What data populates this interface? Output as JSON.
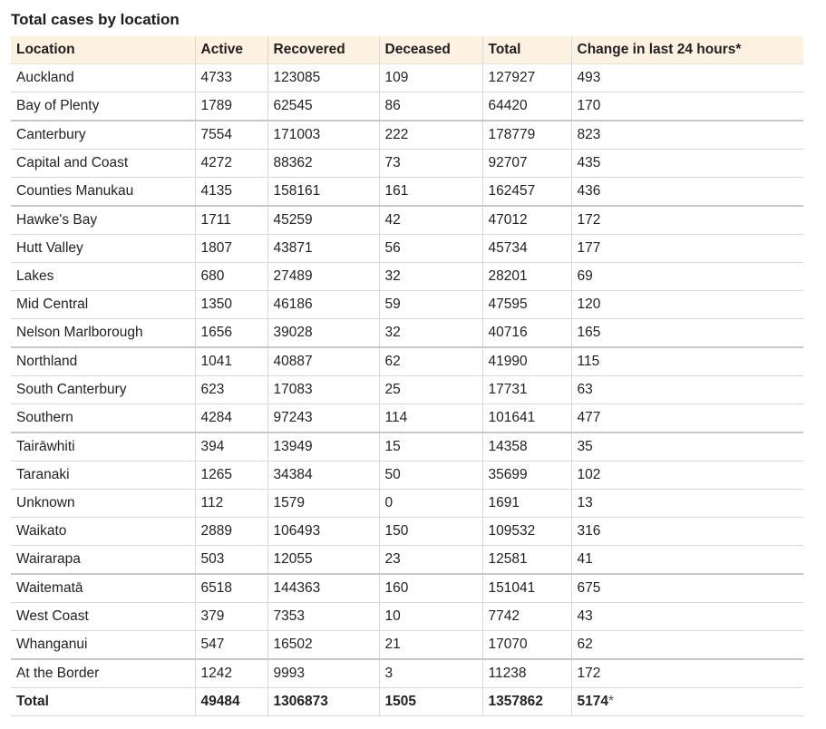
{
  "title": "Total cases by location",
  "columns": [
    "Location",
    "Active",
    "Recovered",
    "Deceased",
    "Total",
    "Change in last 24 hours*"
  ],
  "rows": [
    [
      "Auckland",
      "4733",
      "123085",
      "109",
      "127927",
      "493"
    ],
    [
      "Bay of Plenty",
      "1789",
      "62545",
      "86",
      "64420",
      "170"
    ],
    [
      "Canterbury",
      "7554",
      "171003",
      "222",
      "178779",
      "823"
    ],
    [
      "Capital and Coast",
      "4272",
      "88362",
      "73",
      "92707",
      "435"
    ],
    [
      "Counties Manukau",
      "4135",
      "158161",
      "161",
      "162457",
      "436"
    ],
    [
      "Hawke's Bay",
      "1711",
      "45259",
      "42",
      "47012",
      "172"
    ],
    [
      "Hutt Valley",
      "1807",
      "43871",
      "56",
      "45734",
      "177"
    ],
    [
      "Lakes",
      "680",
      "27489",
      "32",
      "28201",
      "69"
    ],
    [
      "Mid Central",
      "1350",
      "46186",
      "59",
      "47595",
      "120"
    ],
    [
      "Nelson Marlborough",
      "1656",
      "39028",
      "32",
      "40716",
      "165"
    ],
    [
      "Northland",
      "1041",
      "40887",
      "62",
      "41990",
      "115"
    ],
    [
      "South Canterbury",
      "623",
      "17083",
      "25",
      "17731",
      "63"
    ],
    [
      "Southern",
      "4284",
      "97243",
      "114",
      "101641",
      "477"
    ],
    [
      "Tairāwhiti",
      "394",
      "13949",
      "15",
      "14358",
      "35"
    ],
    [
      "Taranaki",
      "1265",
      "34384",
      "50",
      "35699",
      "102"
    ],
    [
      "Unknown",
      "112",
      "1579",
      "0",
      "1691",
      "13"
    ],
    [
      "Waikato",
      "2889",
      "106493",
      "150",
      "109532",
      "316"
    ],
    [
      "Wairarapa",
      "503",
      "12055",
      "23",
      "12581",
      "41"
    ],
    [
      "Waitematā",
      "6518",
      "144363",
      "160",
      "151041",
      "675"
    ],
    [
      "West Coast",
      "379",
      "7353",
      "10",
      "7742",
      "43"
    ],
    [
      "Whanganui",
      "547",
      "16502",
      "21",
      "17070",
      "62"
    ],
    [
      "At the Border",
      "1242",
      "9993",
      "3",
      "11238",
      "172"
    ]
  ],
  "total": {
    "label": "Total",
    "active": "49484",
    "recovered": "1306873",
    "deceased": "1505",
    "total": "1357862",
    "change": "5174",
    "change_mark": "*"
  }
}
